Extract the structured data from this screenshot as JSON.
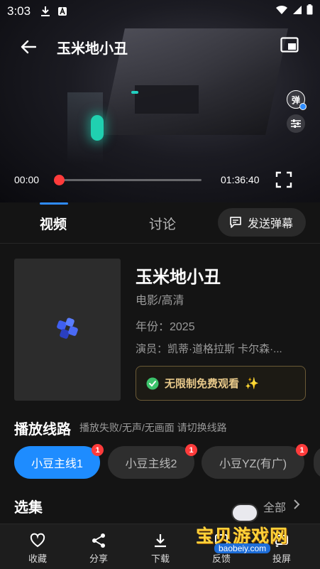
{
  "status_bar": {
    "time": "3:03",
    "icons": [
      "download-icon",
      "a-icon",
      "wifi-icon",
      "signal-icon",
      "battery-icon"
    ]
  },
  "player": {
    "title": "玉米地小丑",
    "danmu_label": "弹",
    "current_time": "00:00",
    "total_time": "01:36:40",
    "progress": 0.0
  },
  "tabs": [
    {
      "label": "视频",
      "active": true
    },
    {
      "label": "讨论",
      "active": false
    }
  ],
  "send_danmu_label": "发送弹幕",
  "info": {
    "title": "玉米地小丑",
    "type": "电影/高清",
    "year": "年份：2025",
    "cast": "演员：凯蒂·道格拉斯 卡尔森·...",
    "free_text": "无限制免费观看"
  },
  "lines": {
    "title": "播放线路",
    "hint": "播放失败/无声/无画面 请切换线路",
    "items": [
      {
        "label": "小豆主线1",
        "badge": "1",
        "active": true
      },
      {
        "label": "小豆主线2",
        "badge": "1",
        "active": false
      },
      {
        "label": "小豆YZ(有广)",
        "badge": "1",
        "active": false
      }
    ]
  },
  "episodes": {
    "title": "选集",
    "all_label": "全部"
  },
  "bottom_bar": [
    {
      "label": "收藏",
      "icon": "heart-icon"
    },
    {
      "label": "分享",
      "icon": "share-icon"
    },
    {
      "label": "下载",
      "icon": "download-icon"
    },
    {
      "label": "反馈",
      "icon": "feedback-icon"
    },
    {
      "label": "投屏",
      "icon": "cast-icon"
    }
  ],
  "watermark": {
    "text": "宝贝游戏网",
    "url": "baobeiy.com"
  },
  "colors": {
    "accent": "#1e8cff",
    "progress_thumb": "#ff3b3b",
    "free_gold": "#e8c98a",
    "background": "#141414"
  }
}
